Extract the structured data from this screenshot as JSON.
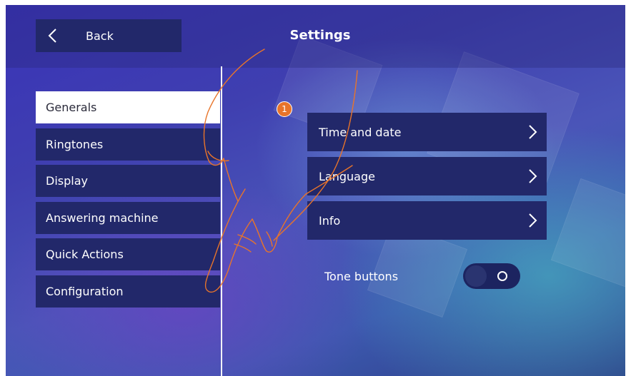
{
  "header": {
    "back_label": "Back",
    "title": "Settings"
  },
  "menu": {
    "items": [
      {
        "label": "Generals",
        "active": true
      },
      {
        "label": "Ringtones",
        "active": false
      },
      {
        "label": "Display",
        "active": false
      },
      {
        "label": "Answering machine",
        "active": false
      },
      {
        "label": "Quick Actions",
        "active": false
      },
      {
        "label": "Configuration",
        "active": false
      }
    ]
  },
  "options": [
    {
      "label": "Time and date"
    },
    {
      "label": "Language"
    },
    {
      "label": "Info"
    }
  ],
  "tone_buttons": {
    "label": "Tone buttons",
    "state": "off"
  },
  "step_marker": "1",
  "colors": {
    "panel": "#22286a",
    "accent": "#e8742a",
    "active_item": "#ffffff"
  },
  "icons": {
    "back": "chevron-left-icon",
    "option": "chevron-right-icon",
    "hand": "pointing-hand-icon"
  }
}
